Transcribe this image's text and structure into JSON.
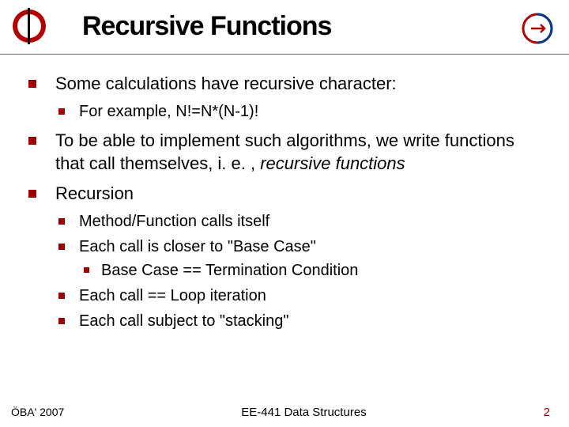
{
  "header": {
    "title": "Recursive Functions"
  },
  "bullets": {
    "b1": "Some calculations have recursive character:",
    "b1_1": "For example, N!=N*(N-1)!",
    "b2_pre": "To be able to implement such algorithms, we write functions that call themselves, i. e. , ",
    "b2_em": "recursive functions",
    "b3": "Recursion",
    "b3_1": "Method/Function calls itself",
    "b3_2": "Each call is closer to \"Base Case\"",
    "b3_2_1": "Base Case == Termination Condition",
    "b3_3": "Each call == Loop iteration",
    "b3_4": "Each call subject to \"stacking\""
  },
  "footer": {
    "left": "ÖBA' 2007",
    "center": "EE-441 Data Structures",
    "right": "2"
  }
}
